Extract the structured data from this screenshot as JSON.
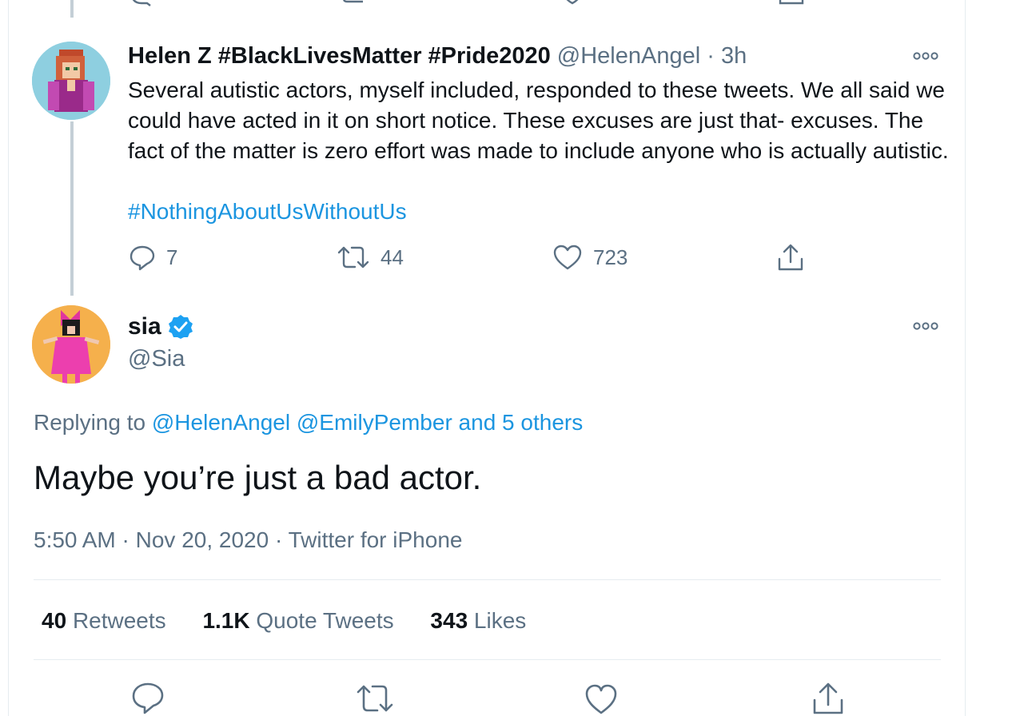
{
  "reply_tweet": {
    "display_name": "Helen Z #BlackLivesMatter #Pride2020",
    "handle": "@HelenAngel",
    "separator": "·",
    "time": "3h",
    "text": "Several autistic actors, myself included, responded to these tweets. We all said we could have acted in it on short notice. These excuses are just that- excuses. The fact of the matter is zero effort was made to include anyone who is actually autistic.",
    "hashtag": "#NothingAboutUsWithoutUs",
    "reply_count": "7",
    "retweet_count": "44",
    "like_count": "723"
  },
  "main_tweet": {
    "display_name": "sia",
    "handle": "@Sia",
    "replying_prefix": "Replying to",
    "replying_to_1": "@HelenAngel",
    "replying_to_2": "@EmilyPember",
    "replying_others": "and 5 others",
    "text": "Maybe you’re just a bad actor.",
    "time": "5:50 AM",
    "date": "Nov 20, 2020",
    "source": "Twitter for iPhone",
    "dot": "·",
    "stats": {
      "retweets_count": "40",
      "retweets_label": "Retweets",
      "quote_count": "1.1K",
      "quote_label": "Quote Tweets",
      "likes_count": "343",
      "likes_label": "Likes"
    }
  },
  "colors": {
    "text": "#0f1419",
    "muted": "#5b7083",
    "link": "#1b95e0",
    "verified": "#1da1f2",
    "border": "#e6ecf0"
  },
  "icons": [
    "reply-icon",
    "retweet-icon",
    "like-icon",
    "share-icon",
    "more-icon",
    "verified-icon"
  ]
}
